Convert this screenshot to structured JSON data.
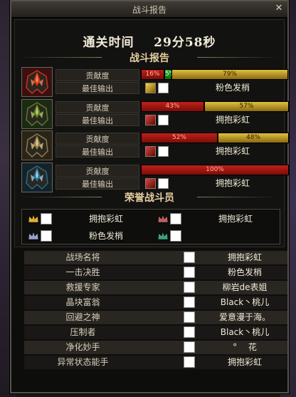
{
  "window": {
    "title": "战斗报告",
    "close_symbol": "✕"
  },
  "clear_time": {
    "label": "通关时间",
    "value": "29分58秒"
  },
  "report_section": {
    "title": "战斗报告"
  },
  "players": [
    {
      "contribution_label": "贡献度",
      "best_label": "最佳输出",
      "weapon_color": "yellow",
      "bars": [
        {
          "color": "red",
          "value": 16,
          "text": "16%"
        },
        {
          "color": "green",
          "value": 5,
          "text": "5%"
        },
        {
          "color": "gold",
          "value": 79,
          "text": "79%"
        }
      ],
      "best_player": "粉色发梢",
      "portrait_theme": "red"
    },
    {
      "contribution_label": "贡献度",
      "best_label": "最佳输出",
      "weapon_color": "red",
      "bars": [
        {
          "color": "red",
          "value": 43,
          "text": "43%"
        },
        {
          "color": "gold",
          "value": 57,
          "text": "57%"
        }
      ],
      "best_player": "拥抱彩虹",
      "portrait_theme": "green"
    },
    {
      "contribution_label": "贡献度",
      "best_label": "最佳输出",
      "weapon_color": "red",
      "bars": [
        {
          "color": "red",
          "value": 52,
          "text": "52%"
        },
        {
          "color": "gold",
          "value": 48,
          "text": "48%"
        }
      ],
      "best_player": "拥抱彩虹",
      "portrait_theme": "gold"
    },
    {
      "contribution_label": "贡献度",
      "best_label": "最佳输出",
      "weapon_color": "red",
      "bars": [
        {
          "color": "red",
          "value": 100,
          "text": "100%"
        }
      ],
      "best_player": "拥抱彩虹",
      "portrait_theme": "blue"
    }
  ],
  "honor_section": {
    "title": "荣誉战斗员"
  },
  "honor_members": [
    {
      "name": "拥抱彩虹",
      "crown_color": "#e0b030"
    },
    {
      "name": "拥抱彩虹",
      "crown_color": "#c06060"
    },
    {
      "name": "粉色发梢",
      "crown_color": "#9aa0c8"
    },
    {
      "name": "",
      "crown_color": "#40a080"
    }
  ],
  "awards": [
    {
      "title": "战场名将",
      "player": "拥抱彩虹"
    },
    {
      "title": "一击决胜",
      "player": "粉色发梢"
    },
    {
      "title": "救援专家",
      "player": "柳岩de表姐"
    },
    {
      "title": "晶块富翁",
      "player": "Black丶桃儿"
    },
    {
      "title": "回避之神",
      "player": "爱意漫于海。"
    },
    {
      "title": "压制者",
      "player": "Black丶桃儿"
    },
    {
      "title": "净化妙手",
      "player": "°　 花"
    },
    {
      "title": "异常状态能手",
      "player": "拥抱彩虹"
    }
  ]
}
